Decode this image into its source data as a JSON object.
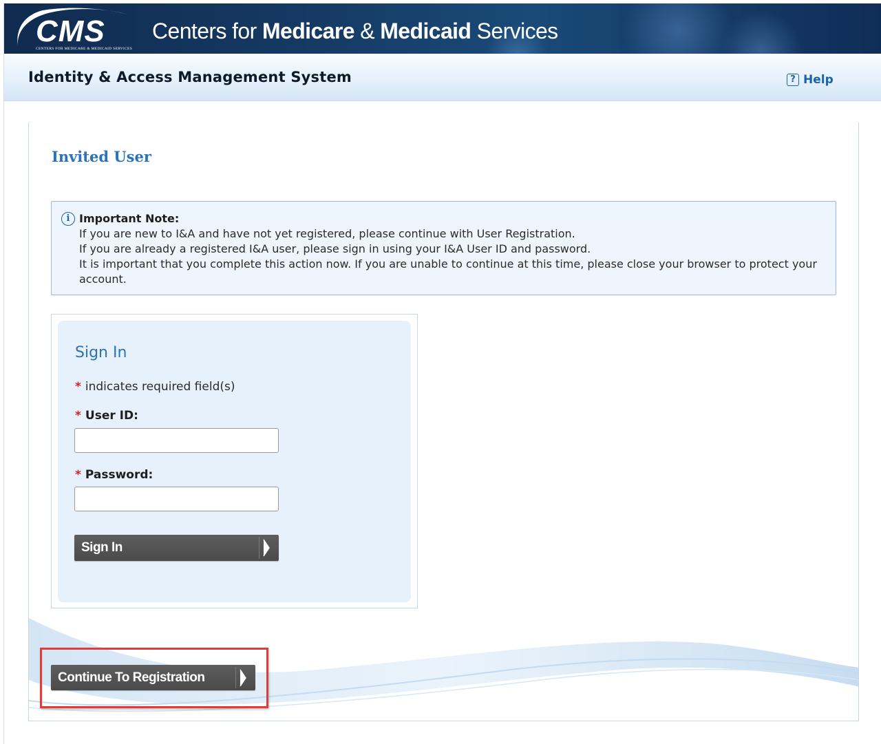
{
  "banner": {
    "logo_text": "CMS",
    "logo_subtitle": "CENTERS FOR MEDICARE & MEDICAID SERVICES",
    "agency_prefix": "Centers for ",
    "agency_medicare": "Medicare",
    "agency_amp": " & ",
    "agency_medicaid": "Medicaid",
    "agency_suffix": " Services"
  },
  "header": {
    "system_title": "Identity & Access Management System",
    "help_icon_glyph": "?",
    "help_label": "Help"
  },
  "main": {
    "page_heading": "Invited User",
    "note": {
      "icon": "info-icon",
      "icon_glyph": "i",
      "title": "Important Note:",
      "lines": [
        "If you are new to I&A and have not yet registered, please continue with User Registration.",
        "If you are already a registered I&A user, please sign in using your I&A User ID and password.",
        "It is important that you complete this action now. If you are unable to continue at this time, please close your browser to protect your account."
      ]
    },
    "signin": {
      "title": "Sign In",
      "required_marker": "*",
      "required_note": "indicates required field(s)",
      "user_id_label": "User ID:",
      "user_id_value": "",
      "password_label": "Password:",
      "password_value": "",
      "button_label": "Sign In"
    },
    "register_button_label": "Continue To Registration"
  },
  "colors": {
    "banner": "#153a63",
    "heading_blue": "#2a73b8",
    "button_gray": "#555555",
    "required_red": "#d22222",
    "highlight_red": "#e23b3b"
  }
}
